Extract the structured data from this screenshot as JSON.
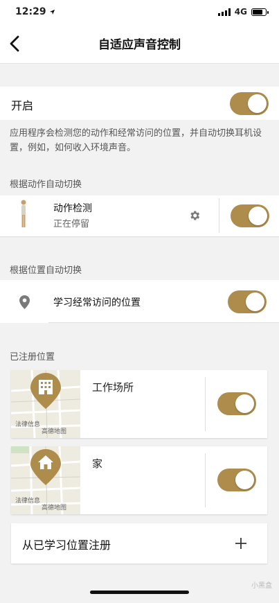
{
  "status_bar": {
    "time": "12:29",
    "network": "4G"
  },
  "nav": {
    "title": "自适应声音控制"
  },
  "enable": {
    "label": "开启",
    "on": true
  },
  "description": "应用程序会检测您的动作和经常访问的位置，并自动切换耳机设置，例如，如何收入环境声音。",
  "motion_section": {
    "header": "根据动作自动切换",
    "title": "动作检测",
    "status": "正在停留",
    "on": true
  },
  "location_section": {
    "header": "根据位置自动切换",
    "label": "学习经常访问的位置",
    "on": true
  },
  "registered": {
    "header": "已注册位置",
    "places": [
      {
        "name": "工作场所",
        "map_label": "法律信息",
        "map_source": "高德地图",
        "icon": "building-icon",
        "on": true
      },
      {
        "name": "家",
        "map_label": "法律信息",
        "map_source": "高德地图",
        "icon": "home-icon",
        "on": true
      }
    ]
  },
  "add_from_learned": {
    "label": "从已学习位置注册",
    "icon": "plus-icon"
  },
  "watermark": "小黑盒",
  "colors": {
    "accent": "#ad8c4c",
    "background": "#f2f2f2"
  }
}
